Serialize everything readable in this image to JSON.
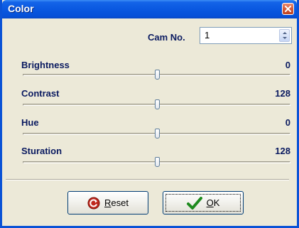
{
  "window": {
    "title": "Color"
  },
  "cam": {
    "label": "Cam No.",
    "value": "1"
  },
  "sliders": [
    {
      "label": "Brightness",
      "value": "0",
      "position": 0.5
    },
    {
      "label": "Contrast",
      "value": "128",
      "position": 0.5
    },
    {
      "label": "Hue",
      "value": "0",
      "position": 0.5
    },
    {
      "label": "Sturation",
      "value": "128",
      "position": 0.5
    }
  ],
  "buttons": {
    "reset_label": "Reset",
    "ok_label": "OK"
  },
  "colors": {
    "title_bar": "#0a58e0",
    "label_text": "#0a1a60",
    "dialog_bg": "#ece9d8",
    "ok_check": "#1e8a1e",
    "reset_icon": "#c0281e"
  },
  "icons": {
    "close": "close-icon",
    "spin": "spin-buttons-icon",
    "reset": "reset-icon",
    "ok": "checkmark-icon"
  }
}
